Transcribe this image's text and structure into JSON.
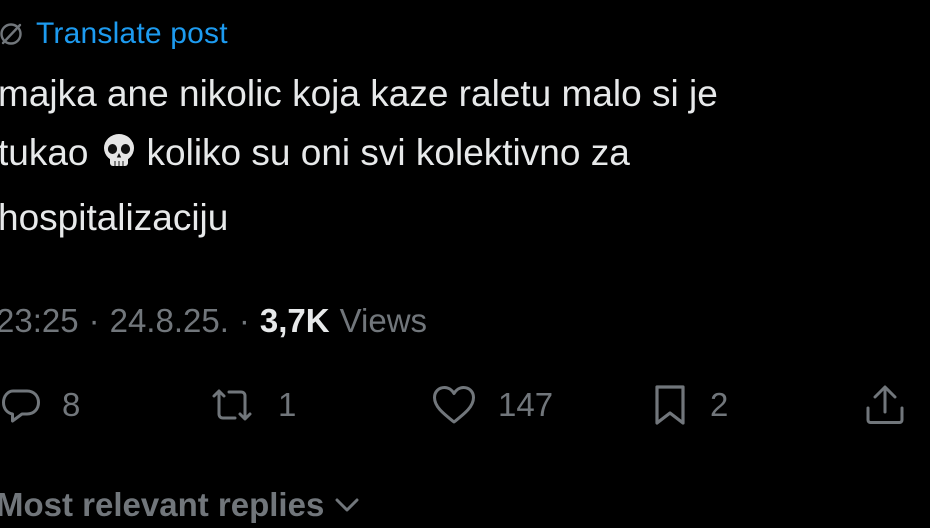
{
  "translate": {
    "icon": "globe-slash-icon",
    "label": "Translate post"
  },
  "post": {
    "line1": "majka ane nikolic koja kaze raletu malo si je",
    "line2_before": "tukao",
    "emoji": "skull-emoji",
    "line2_after": "koliko su oni svi kolektivno za",
    "line3": "hospitalizaciju"
  },
  "meta": {
    "time": "23:25",
    "separator": "·",
    "date": "24.8.25.",
    "views_count": "3,7K",
    "views_label": "Views"
  },
  "actions": {
    "reply": {
      "icon": "reply-bubble-icon",
      "count": "8"
    },
    "repost": {
      "icon": "repost-icon",
      "count": "1"
    },
    "like": {
      "icon": "heart-icon",
      "count": "147"
    },
    "bookmark": {
      "icon": "bookmark-icon",
      "count": "2"
    },
    "share": {
      "icon": "share-upload-icon"
    }
  },
  "replies": {
    "label": "Most relevant replies",
    "icon": "chevron-down-icon"
  },
  "colors": {
    "background": "#000000",
    "text": "#e7e9ea",
    "muted": "#71767b",
    "link": "#1d9bf0"
  }
}
